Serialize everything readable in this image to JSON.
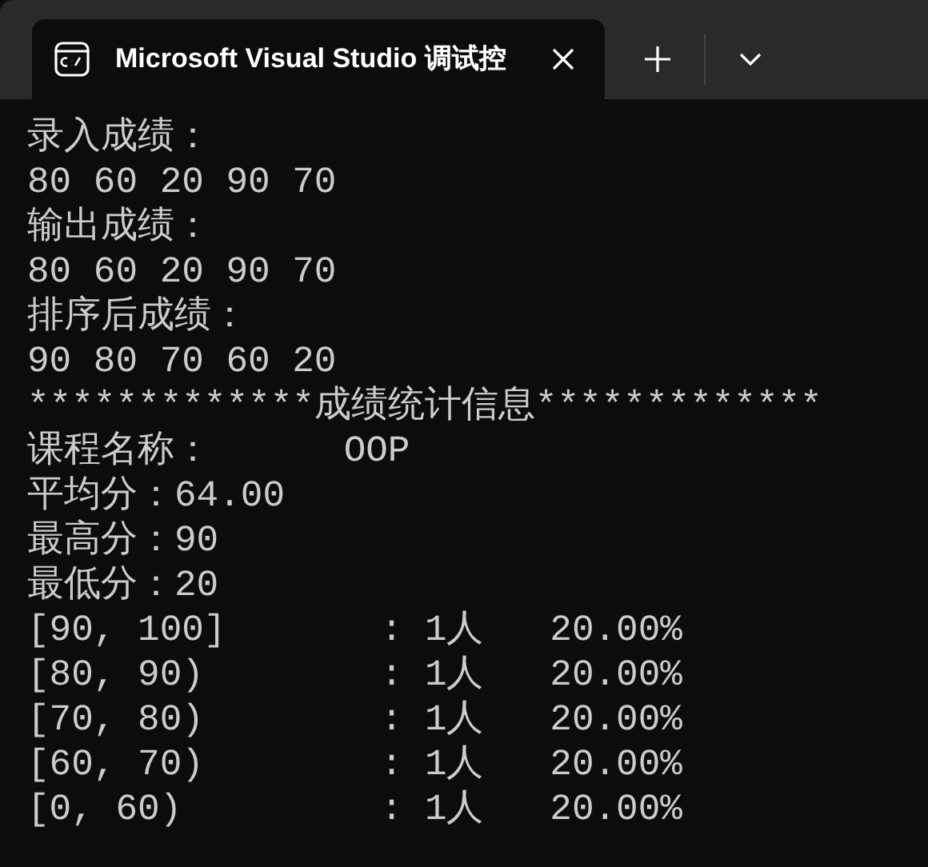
{
  "tab": {
    "title": "Microsoft Visual Studio 调试控"
  },
  "console": {
    "lines": [
      "录入成绩：",
      "80 60 20 90 70",
      "输出成绩：",
      "80 60 20 90 70",
      "排序后成绩：",
      "90 80 70 60 20",
      "*************成绩统计信息*************",
      "课程名称：      OOP",
      "平均分：64.00",
      "最高分：90",
      "最低分：20",
      "[90, 100]       : 1人   20.00%",
      "[80, 90)        : 1人   20.00%",
      "[70, 80)        : 1人   20.00%",
      "[60, 70)        : 1人   20.00%",
      "[0, 60)         : 1人   20.00%"
    ]
  }
}
